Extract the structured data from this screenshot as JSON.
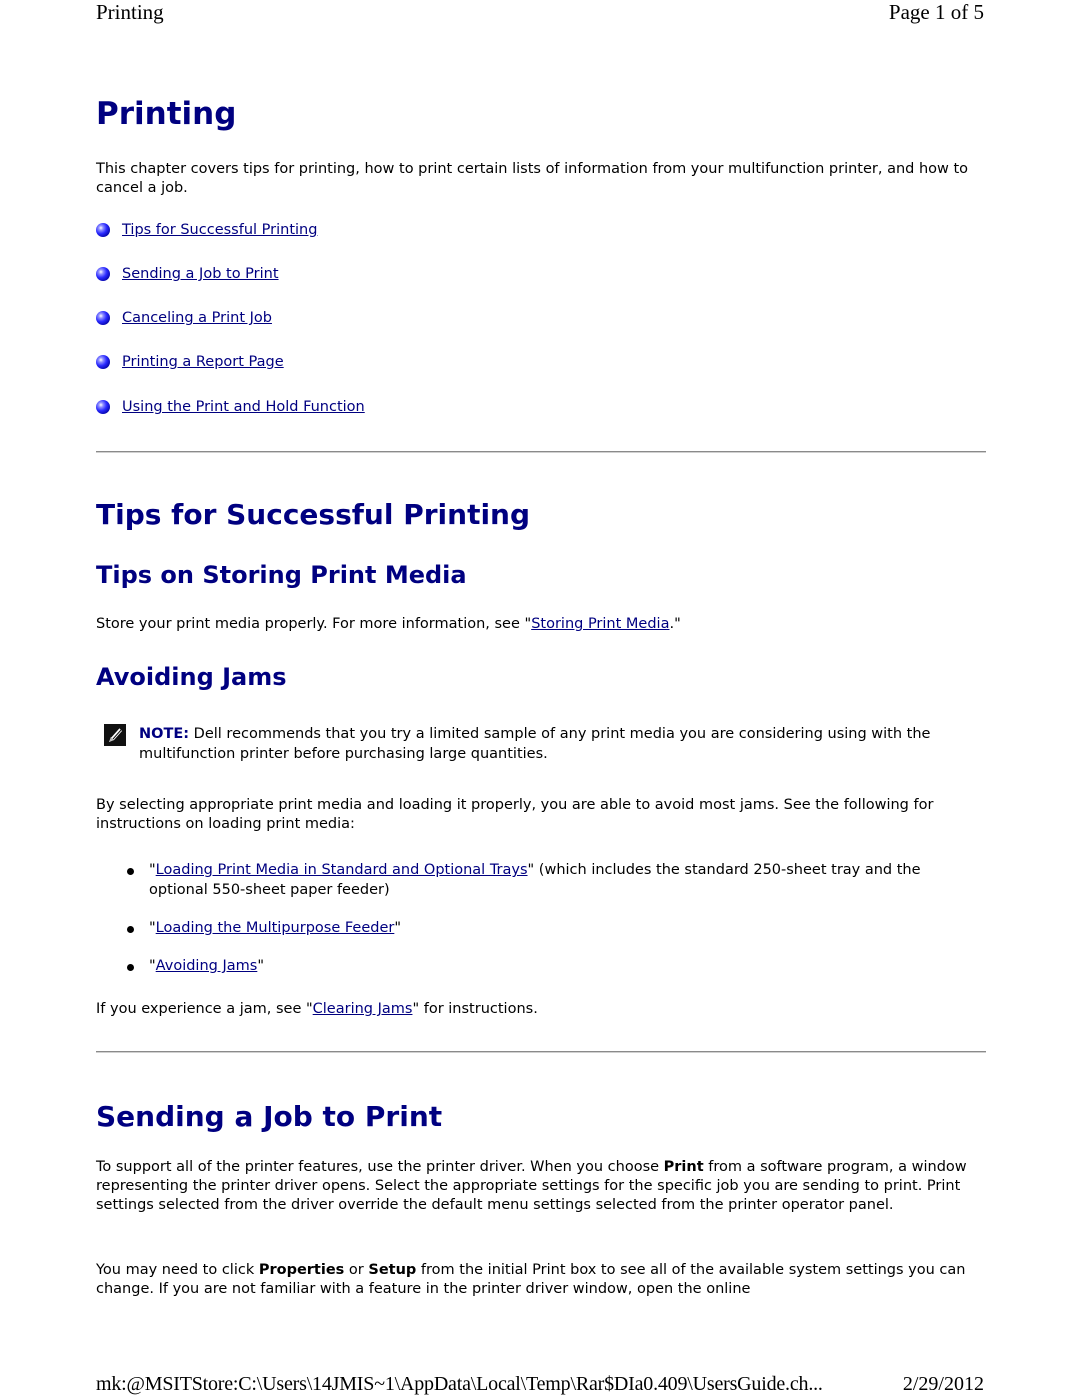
{
  "page_header": {
    "title": "Printing",
    "page_indicator": "Page 1 of 5"
  },
  "page_footer": {
    "address": "mk:@MSITStore:C:\\Users\\14JMIS~1\\AppData\\Local\\Temp\\Rar$DIa0.409\\UsersGuide.ch...",
    "date": "2/29/2012"
  },
  "main": {
    "title": "Printing",
    "intro": "This chapter covers tips for printing, how to print certain lists of information from your multifunction printer, and how to cancel a job.",
    "toc": [
      {
        "label": "Tips for Successful Printing",
        "icon": "blue-orb-bullet-icon"
      },
      {
        "label": "Sending a Job to Print",
        "icon": "blue-orb-bullet-icon"
      },
      {
        "label": "Canceling a Print Job",
        "icon": "blue-orb-bullet-icon"
      },
      {
        "label": "Printing a Report Page",
        "icon": "blue-orb-bullet-icon"
      },
      {
        "label": "Using the Print and Hold Function",
        "icon": "blue-orb-bullet-icon"
      }
    ]
  },
  "tips_section": {
    "title": "Tips for Successful Printing",
    "storing": {
      "title": "Tips on Storing Print Media",
      "text_before": "Store your print media properly. For more information, see \"",
      "link": "Storing Print Media",
      "text_after": ".\""
    },
    "jams": {
      "title": "Avoiding Jams",
      "note": {
        "icon": "pencil-note-icon",
        "label": "NOTE:",
        "text": " Dell recommends that you try a limited sample of any print media you are considering using with the multifunction printer before purchasing large quantities."
      },
      "para": "By selecting appropriate print media and loading it properly, you are able to avoid most jams. See the following for instructions on loading print media:",
      "bullets": [
        {
          "pre": "\"",
          "link": "Loading Print Media in Standard and Optional Trays",
          "post": "\" (which includes the standard 250-sheet tray and the optional 550-sheet paper feeder)"
        },
        {
          "pre": "\"",
          "link": "Loading the Multipurpose Feeder",
          "post": "\""
        },
        {
          "pre": "\"",
          "link": "Avoiding Jams",
          "post": "\""
        }
      ],
      "closing_before": "If you experience a jam, see \"",
      "closing_link": "Clearing Jams",
      "closing_after": "\" for instructions."
    }
  },
  "sending_section": {
    "title": "Sending a Job to Print",
    "p1_a": "To support all of the printer features, use the printer driver. When you choose ",
    "p1_bold": "Print",
    "p1_b": " from a software program, a window representing the printer driver opens. Select the appropriate settings for the specific job you are sending to print. Print settings selected from the driver override the default menu settings selected from the printer operator panel.",
    "p2_a": "You may need to click ",
    "p2_bold1": "Properties",
    "p2_b": " or ",
    "p2_bold2": "Setup",
    "p2_c": " from the initial Print box to see all of the available system settings you can change. If you are not familiar with a feature in the printer driver window, open the online"
  },
  "colors": {
    "heading": "#000080",
    "link": "#000080",
    "text": "#000000"
  }
}
